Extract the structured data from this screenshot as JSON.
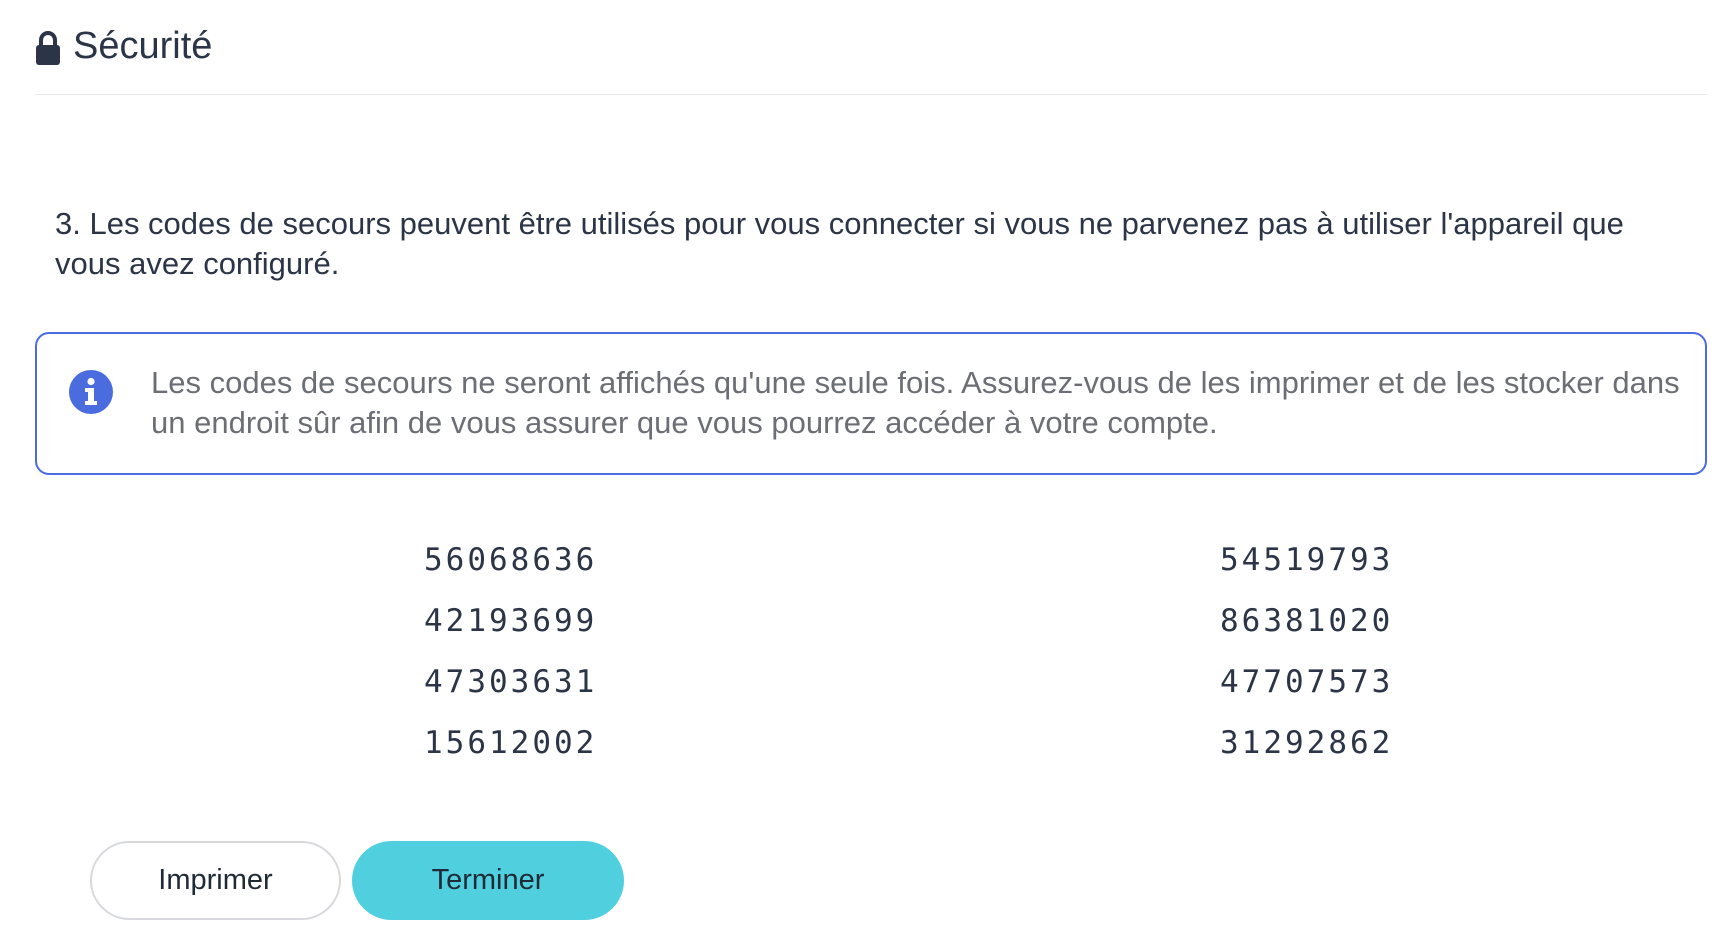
{
  "header": {
    "icon": "lock-icon",
    "title": "Sécurité"
  },
  "step": {
    "text": "3. Les codes de secours peuvent être utilisés pour vous connecter si vous ne parvenez pas à utiliser l'appareil que vous avez configuré."
  },
  "info": {
    "icon": "info-icon",
    "accent_color": "#4a6cde",
    "text": "Les codes de secours ne seront affichés qu'une seule fois. Assurez-vous de les imprimer et de les stocker dans un endroit sûr afin de vous assurer que vous pourrez accéder à votre compte."
  },
  "codes": {
    "left": [
      "56068636",
      "42193699",
      "47303631",
      "15612002"
    ],
    "right": [
      "54519793",
      "86381020",
      "47707573",
      "31292862"
    ]
  },
  "actions": {
    "print_label": "Imprimer",
    "finish_label": "Terminer",
    "finish_color": "#50d0de"
  }
}
